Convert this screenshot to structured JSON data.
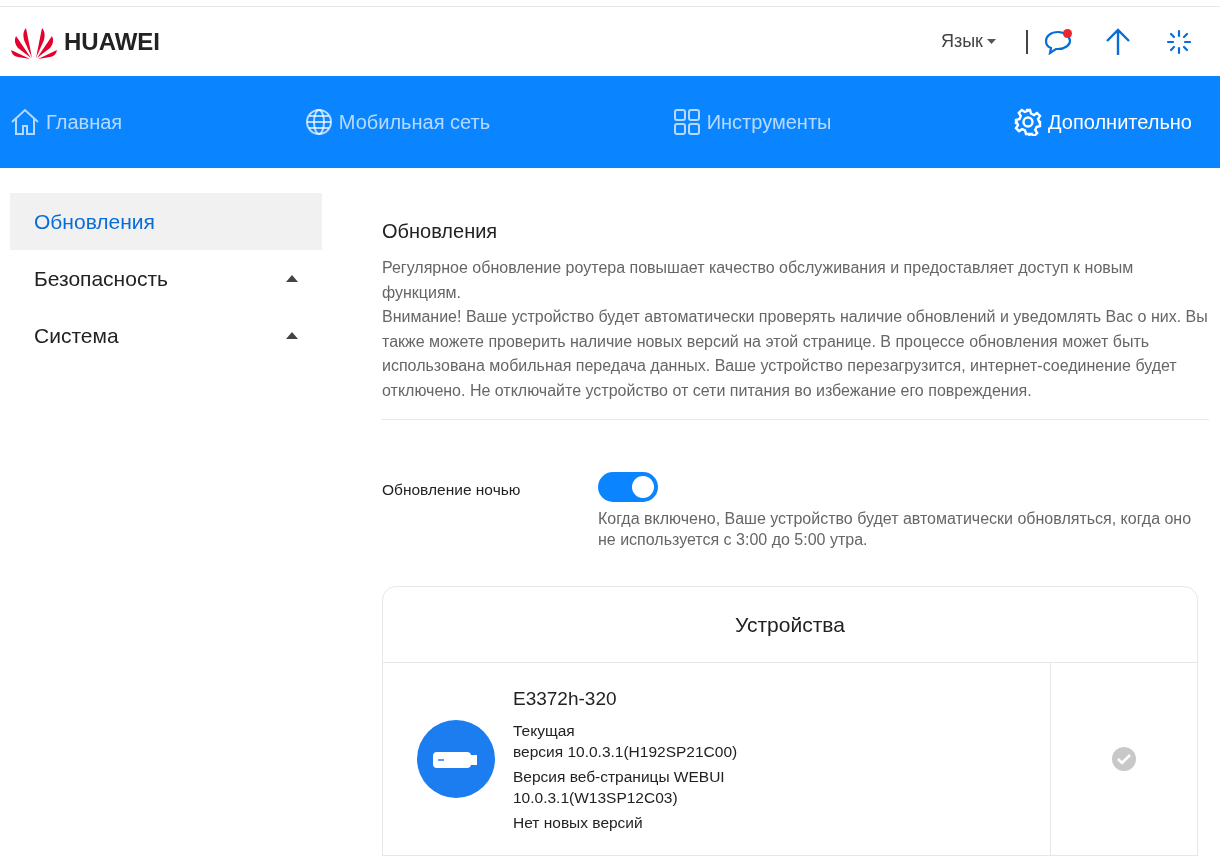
{
  "header": {
    "logo": "HUAWEI",
    "language": "Язык",
    "message_unread": true
  },
  "nav": [
    {
      "label": "Главная",
      "selected": false
    },
    {
      "label": "Мобильная сеть",
      "selected": false
    },
    {
      "label": "Инструменты",
      "selected": false
    },
    {
      "label": "Дополнительно",
      "selected": true
    }
  ],
  "sidebar": {
    "items": [
      {
        "label": "Обновления",
        "selected": true
      },
      {
        "label": "Безопасность",
        "selected": false,
        "expanded": false
      },
      {
        "label": "Система",
        "selected": false,
        "expanded": false
      }
    ]
  },
  "content": {
    "title": "Обновления",
    "paragraphs": [
      "Регулярное обновление роутера повышает качество обслуживания и предоставляет доступ к новым функциям.",
      "Внимание! Ваше устройство будет автоматически проверять наличие обновлений и уведомлять Вас о них. Вы также можете проверить наличие новых версий на этой странице. В процессе обновления может быть использована мобильная передача данных. Ваше устройство перезагрузится, интернет-соединение будет отключено. Не отключайте устройство от сети питания во избежание его повреждения."
    ],
    "night_update": {
      "label": "Обновление ночью",
      "on": true,
      "hint": "Когда включено, Ваше устройство будет автоматически обновляться, когда оно не используется с 3:00 до 5:00 утра."
    },
    "devices": {
      "title": "Устройства",
      "items": [
        {
          "name": "E3372h-320",
          "current_version": "Текущая\nверсия 10.0.3.1(H192SP21C00)",
          "webui_version": "Версия веб-страницы WEBUI\n10.0.3.1(W13SP12C03)",
          "status": "Нет новых версий",
          "up_to_date": true
        }
      ]
    }
  }
}
